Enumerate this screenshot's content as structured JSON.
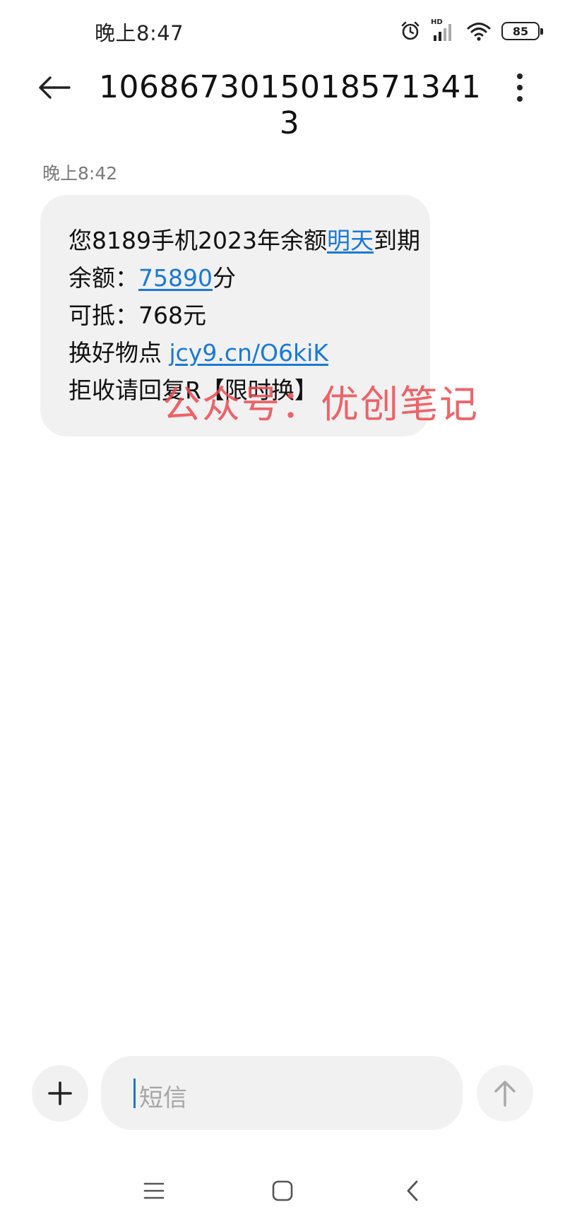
{
  "status_bar": {
    "time": "晚上8:47",
    "network_badge": "HD",
    "battery_level": "85",
    "icons": [
      "alarm-icon",
      "signal-icon",
      "wifi-icon",
      "battery-icon"
    ]
  },
  "header": {
    "title": "1068673015018571341 3",
    "back_icon": "arrow-left-icon",
    "more_icon": "more-vertical-icon"
  },
  "thread": {
    "timestamp": "晚上8:42",
    "message": {
      "line1": {
        "before": "您8189手机2023年余额",
        "link": "明天",
        "after": "到期"
      },
      "line2": {
        "before": "余额：",
        "link": "75890",
        "after": "分"
      },
      "line3": "可抵：768元",
      "line4": {
        "before": "换好物点 ",
        "link": "jcy9.cn/O6kiK"
      },
      "line5": "拒收请回复R【限时换】"
    }
  },
  "watermark": "公众号：优创笔记",
  "composer": {
    "placeholder": "短信",
    "add_icon": "plus-icon",
    "send_icon": "arrow-up-icon"
  },
  "nav_bar": {
    "icons": [
      "menu-icon",
      "home-icon",
      "back-chevron-icon"
    ]
  },
  "colors": {
    "link": "#1a79d6",
    "bubble": "#f1f1f1",
    "watermark": "#ec4b51"
  }
}
